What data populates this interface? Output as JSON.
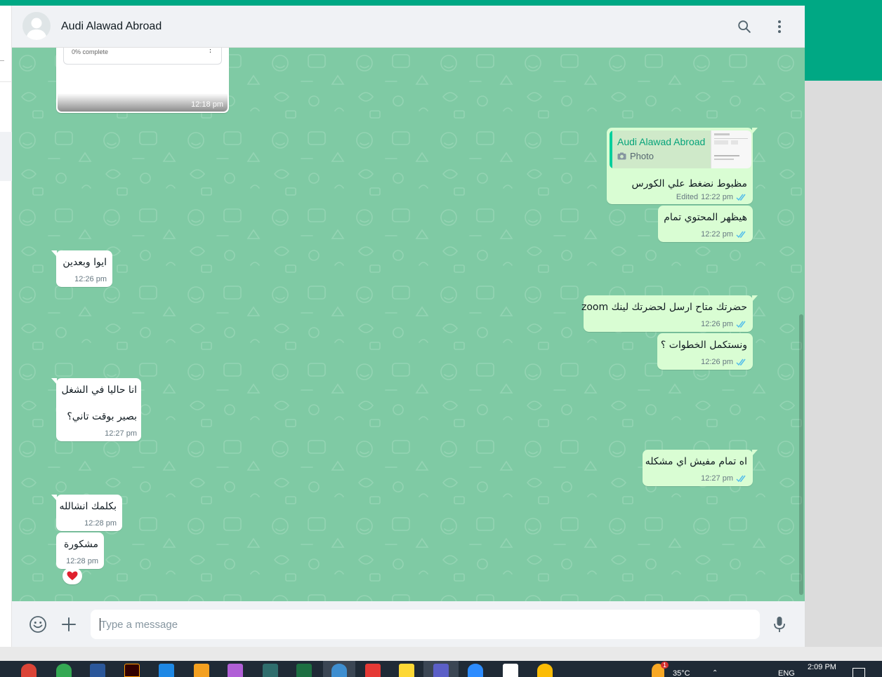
{
  "header": {
    "contact_name": "Audi Alawad Abroad"
  },
  "chat": {
    "image_message": {
      "progress": "0% complete",
      "time": "12:18 pm"
    },
    "messages": [
      {
        "direction": "out",
        "reply_to_name": "Audi Alawad Abroad",
        "reply_to_type": "Photo",
        "text": "مظبوط نضغط علي الكورس",
        "edited": "Edited",
        "time": "12:22 pm"
      },
      {
        "direction": "out",
        "text": "هيظهر المحتوي تمام",
        "time": "12:22 pm"
      },
      {
        "direction": "in",
        "text": "ايوا وبعدين",
        "time": "12:26 pm"
      },
      {
        "direction": "out",
        "text": "حضرتك متاح ارسل لحضرتك لينك zoom",
        "time": "12:26 pm"
      },
      {
        "direction": "out",
        "text": "ونستكمل الخطوات ؟",
        "time": "12:26 pm"
      },
      {
        "direction": "in",
        "text": "انا حاليا في الشغل",
        "text2": "بصير بوقت تاني؟",
        "time": "12:27 pm"
      },
      {
        "direction": "out",
        "text": "اه تمام مفيش اي مشكله",
        "time": "12:27 pm"
      },
      {
        "direction": "in",
        "text": "بكلمك انشالله",
        "time": "12:28 pm"
      },
      {
        "direction": "in",
        "text": "مشكورة",
        "time": "12:28 pm",
        "reaction": "❤️"
      }
    ]
  },
  "composer": {
    "placeholder": "Type a message"
  },
  "taskbar": {
    "weather_badge": "1",
    "temperature": "35°C",
    "language": "ENG",
    "time": "2:09 PM"
  },
  "colors": {
    "accent": "#00a884",
    "chat_background": "#7fcaa4",
    "incoming_bubble": "#ffffff",
    "outgoing_bubble": "#d9fdd3",
    "read_ticks": "#53bdeb"
  }
}
